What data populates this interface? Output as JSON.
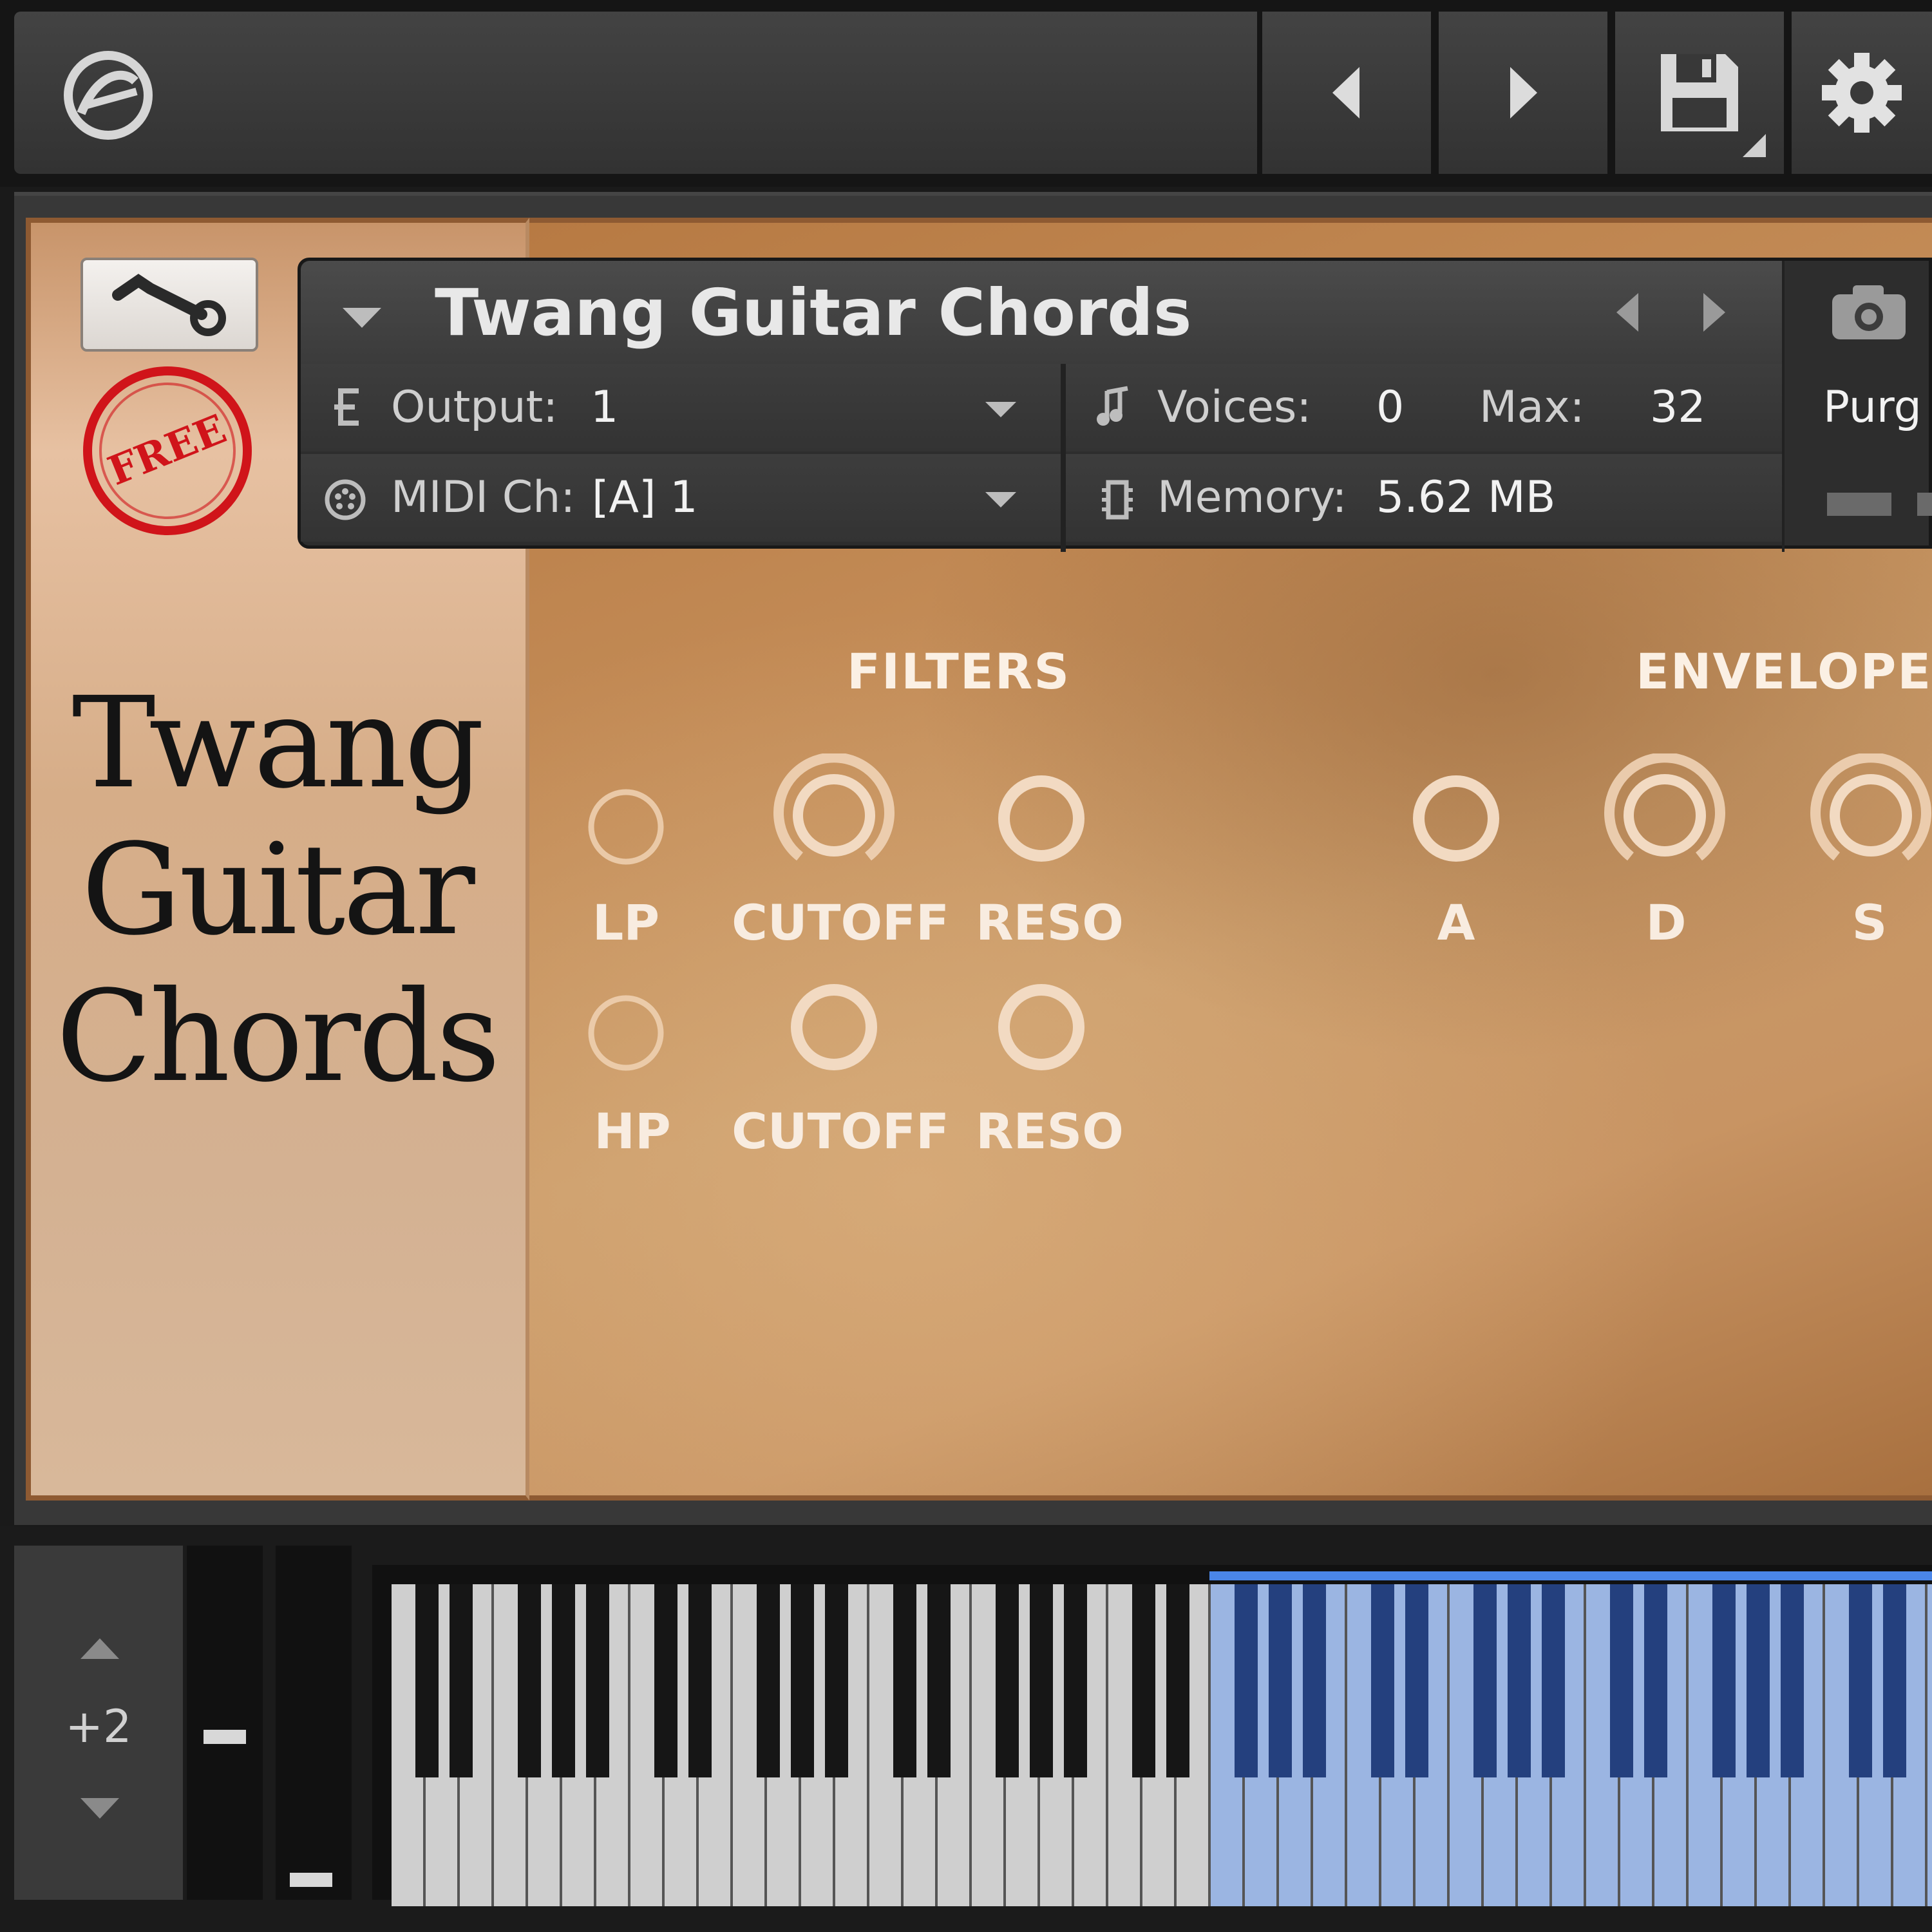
{
  "toolbar": {
    "buttons": [
      "logo",
      "prev",
      "next",
      "save",
      "settings"
    ]
  },
  "header": {
    "instrument_name": "Twang Guitar Chords",
    "output_label": "Output:",
    "output_value": "1",
    "midi_label": "MIDI Ch:",
    "midi_value": "[A]  1",
    "voices_label": "Voices:",
    "voices_value": "0",
    "max_label": "Max:",
    "max_value": "32",
    "memory_label": "Memory:",
    "memory_value": "5.62 MB",
    "purge_label": "Purg"
  },
  "brand": {
    "stamp": "FREE",
    "title_lines": [
      "Twang",
      "Guitar",
      "Chords"
    ]
  },
  "filters": {
    "title": "FILTERS",
    "row1": [
      "LP",
      "CUTOFF",
      "RESO"
    ],
    "row2": [
      "HP",
      "CUTOFF",
      "RESO"
    ]
  },
  "envelope": {
    "title": "ENVELOPE",
    "labels": [
      "A",
      "D",
      "S"
    ]
  },
  "keyboard": {
    "octave_value": "+2"
  },
  "colors": {
    "accent_blue": "#8fb0e0",
    "panel_wood": "#c28a55",
    "stamp_red": "#d0141a"
  }
}
